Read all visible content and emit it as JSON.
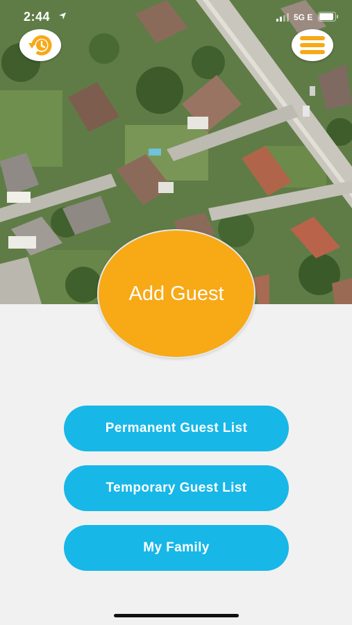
{
  "status_bar": {
    "time": "2:44",
    "network": "5G E"
  },
  "header": {
    "history_button_icon": "clock-history-icon",
    "menu_button_icon": "hamburger-menu-icon"
  },
  "main": {
    "add_guest_label": "Add Guest",
    "buttons": [
      {
        "label": "Permanent Guest List"
      },
      {
        "label": "Temporary Guest List"
      },
      {
        "label": "My Family"
      }
    ]
  },
  "colors": {
    "accent_orange": "#f7a916",
    "accent_blue": "#17b7e8",
    "background": "#f1f1f1"
  }
}
